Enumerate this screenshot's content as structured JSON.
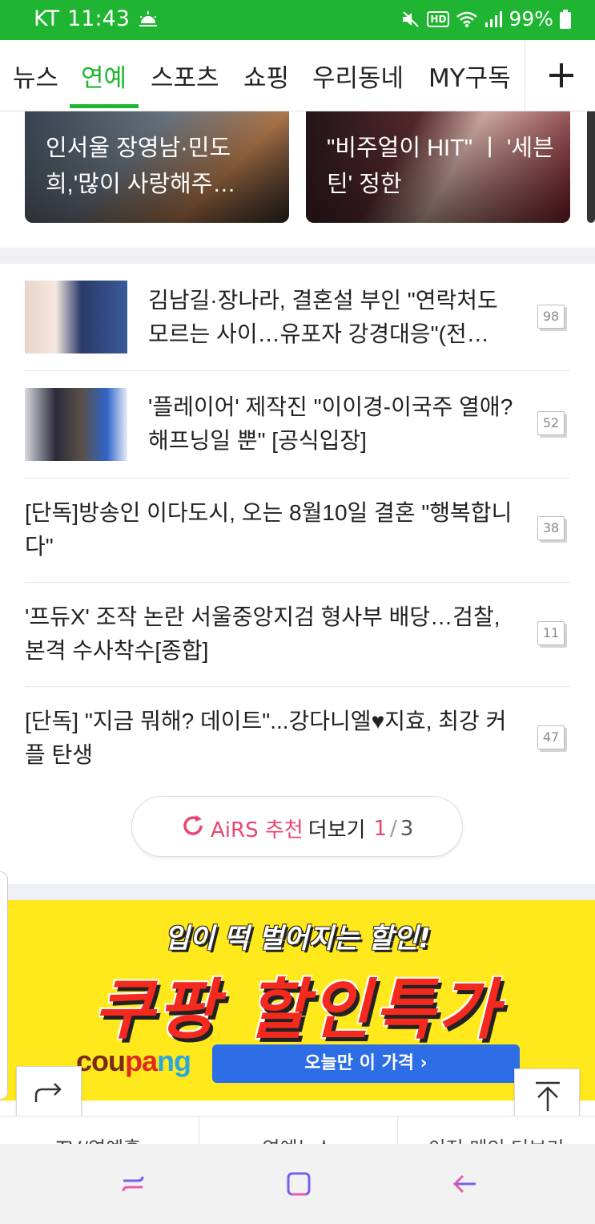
{
  "status_bar": {
    "carrier": "KT",
    "time": "11:43",
    "hd": "HD",
    "battery": "99%",
    "bg_color": "#1fb532"
  },
  "nav": {
    "tabs": [
      {
        "label": "뉴스"
      },
      {
        "label": "연예"
      },
      {
        "label": "스포츠"
      },
      {
        "label": "쇼핑"
      },
      {
        "label": "우리동네"
      },
      {
        "label": "MY구독"
      }
    ],
    "active_tab": "연예",
    "add_icon": "plus-icon",
    "accent": "#1fb532"
  },
  "photo_cards": [
    {
      "title": "인서울 장영남·민도희,'많이 사랑해주…"
    },
    {
      "title": "\"비주얼이 HIT\" ㅣ '세븐틴' 정한"
    }
  ],
  "articles": [
    {
      "title": "김남길·장나라, 결혼설 부인 \"연락처도 모르는 사이…유포자 강경대응\"(전…",
      "count": "98",
      "has_thumb": true
    },
    {
      "title": "'플레이어' 제작진 \"이이경-이국주 열애? 해프닝일 뿐\" [공식입장]",
      "count": "52",
      "has_thumb": true
    },
    {
      "title": "[단독]방송인 이다도시, 오는 8월10일 결혼 \"행복합니다\"",
      "count": "38",
      "has_thumb": false
    },
    {
      "title": "'프듀X' 조작 논란 서울중앙지검 형사부 배당…검찰, 본격 수사착수[종합]",
      "count": "11",
      "has_thumb": false
    },
    {
      "title": "[단독] \"지금 뭐해? 데이트\"...강다니엘♥지효, 최강 커플 탄생",
      "count": "47",
      "has_thumb": false
    }
  ],
  "more_button": {
    "brand": "AiRS 추천",
    "label": "더보기",
    "page": "1",
    "separator": "/",
    "total": "3",
    "accent": "#e8466f"
  },
  "ad": {
    "headline": "입이 떡 벌어지는 할인!",
    "title": "쿠팡 할인특가",
    "brand_parts": [
      "cou",
      "pa",
      "ng"
    ],
    "cta": "오늘만 이 가격 ›",
    "bg_color": "#ffe81c"
  },
  "bottom_links": [
    "TV/연예홈",
    "연예뉴스",
    "이전 메인 더보기"
  ],
  "system_nav": {
    "recent": "recent-apps-icon",
    "home": "home-icon",
    "back": "back-icon"
  }
}
